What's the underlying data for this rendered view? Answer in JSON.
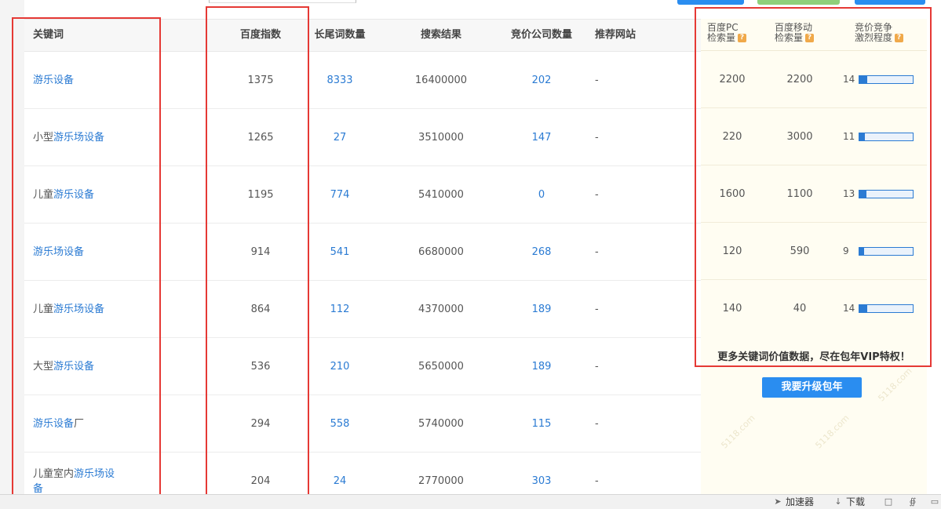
{
  "table": {
    "headers": {
      "keyword": "关键词",
      "baidu_index": "百度指数",
      "long_tail": "长尾词数量",
      "search_results": "搜索结果",
      "bid_companies": "竞价公司数量",
      "recommended_sites": "推荐网站"
    },
    "rows": [
      {
        "keyword_pre": "",
        "keyword_link": "游乐设备",
        "baidu_index": "1375",
        "long_tail": "8333",
        "search_results": "16400000",
        "bid_companies": "202",
        "recommended_site": "-"
      },
      {
        "keyword_pre": "小型",
        "keyword_link": "游乐场设备",
        "baidu_index": "1265",
        "long_tail": "27",
        "search_results": "3510000",
        "bid_companies": "147",
        "recommended_site": "-"
      },
      {
        "keyword_pre": "儿童",
        "keyword_link": "游乐设备",
        "baidu_index": "1195",
        "long_tail": "774",
        "search_results": "5410000",
        "bid_companies": "0",
        "recommended_site": "-"
      },
      {
        "keyword_pre": "",
        "keyword_link": "游乐场设备",
        "baidu_index": "914",
        "long_tail": "541",
        "search_results": "6680000",
        "bid_companies": "268",
        "recommended_site": "-"
      },
      {
        "keyword_pre": "儿童",
        "keyword_link": "游乐场设备",
        "baidu_index": "864",
        "long_tail": "112",
        "search_results": "4370000",
        "bid_companies": "189",
        "recommended_site": "-"
      },
      {
        "keyword_pre": "大型",
        "keyword_link": "游乐设备",
        "baidu_index": "536",
        "long_tail": "210",
        "search_results": "5650000",
        "bid_companies": "189",
        "recommended_site": "-"
      },
      {
        "keyword_pre": "",
        "keyword_link": "游乐设备",
        "keyword_post": "厂",
        "baidu_index": "294",
        "long_tail": "558",
        "search_results": "5740000",
        "bid_companies": "115",
        "recommended_site": "-"
      },
      {
        "keyword_pre": "儿童室内",
        "keyword_link": "游乐场设",
        "keyword_wrap": "备",
        "baidu_index": "204",
        "long_tail": "24",
        "search_results": "2770000",
        "bid_companies": "303",
        "recommended_site": "-"
      }
    ]
  },
  "vip_panel": {
    "headers": {
      "pc_line1": "百度PC",
      "pc_line2": "检索量",
      "mobile_line1": "百度移动",
      "mobile_line2": "检索量",
      "comp_line1": "竞价竞争",
      "comp_line2": "激烈程度",
      "help_glyph": "?"
    },
    "rows": [
      {
        "pc": "2200",
        "mobile": "2200",
        "level": "14",
        "fill": 0.14
      },
      {
        "pc": "220",
        "mobile": "3000",
        "level": "11",
        "fill": 0.11
      },
      {
        "pc": "1600",
        "mobile": "1100",
        "level": "13",
        "fill": 0.13
      },
      {
        "pc": "120",
        "mobile": "590",
        "level": "9",
        "fill": 0.09
      },
      {
        "pc": "140",
        "mobile": "40",
        "level": "14",
        "fill": 0.14
      }
    ],
    "promo_text": "更多关键词价值数据，尽在包年VIP特权！",
    "upgrade_button": "我要升级包年",
    "watermark": "5118.com"
  },
  "statusbar": {
    "accelerator": "加速器",
    "download": "下载"
  },
  "colors": {
    "link": "#2b7bd3",
    "annotation": "#e53935",
    "vip_bg": "#fffdf2",
    "button": "#2a8df0"
  }
}
